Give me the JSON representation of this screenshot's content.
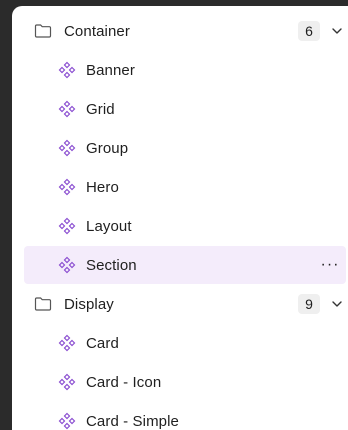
{
  "groups": [
    {
      "label": "Container",
      "count": "6",
      "icon": "folder-icon",
      "expanded": true,
      "items": [
        {
          "label": "Banner",
          "icon": "component-icon"
        },
        {
          "label": "Grid",
          "icon": "component-icon"
        },
        {
          "label": "Group",
          "icon": "component-icon"
        },
        {
          "label": "Hero",
          "icon": "component-icon"
        },
        {
          "label": "Layout",
          "icon": "component-icon"
        },
        {
          "label": "Section",
          "icon": "component-icon",
          "selected": true,
          "more_label": "···"
        }
      ]
    },
    {
      "label": "Display",
      "count": "9",
      "icon": "folder-icon",
      "expanded": true,
      "items": [
        {
          "label": "Card",
          "icon": "component-icon"
        },
        {
          "label": "Card - Icon",
          "icon": "component-icon"
        },
        {
          "label": "Card - Simple",
          "icon": "component-icon"
        }
      ]
    }
  ],
  "colors": {
    "accent": "#8b4ed1",
    "selected_bg": "#f4ecfb",
    "badge_bg": "#efefef",
    "backdrop": "#2b2b2b"
  }
}
